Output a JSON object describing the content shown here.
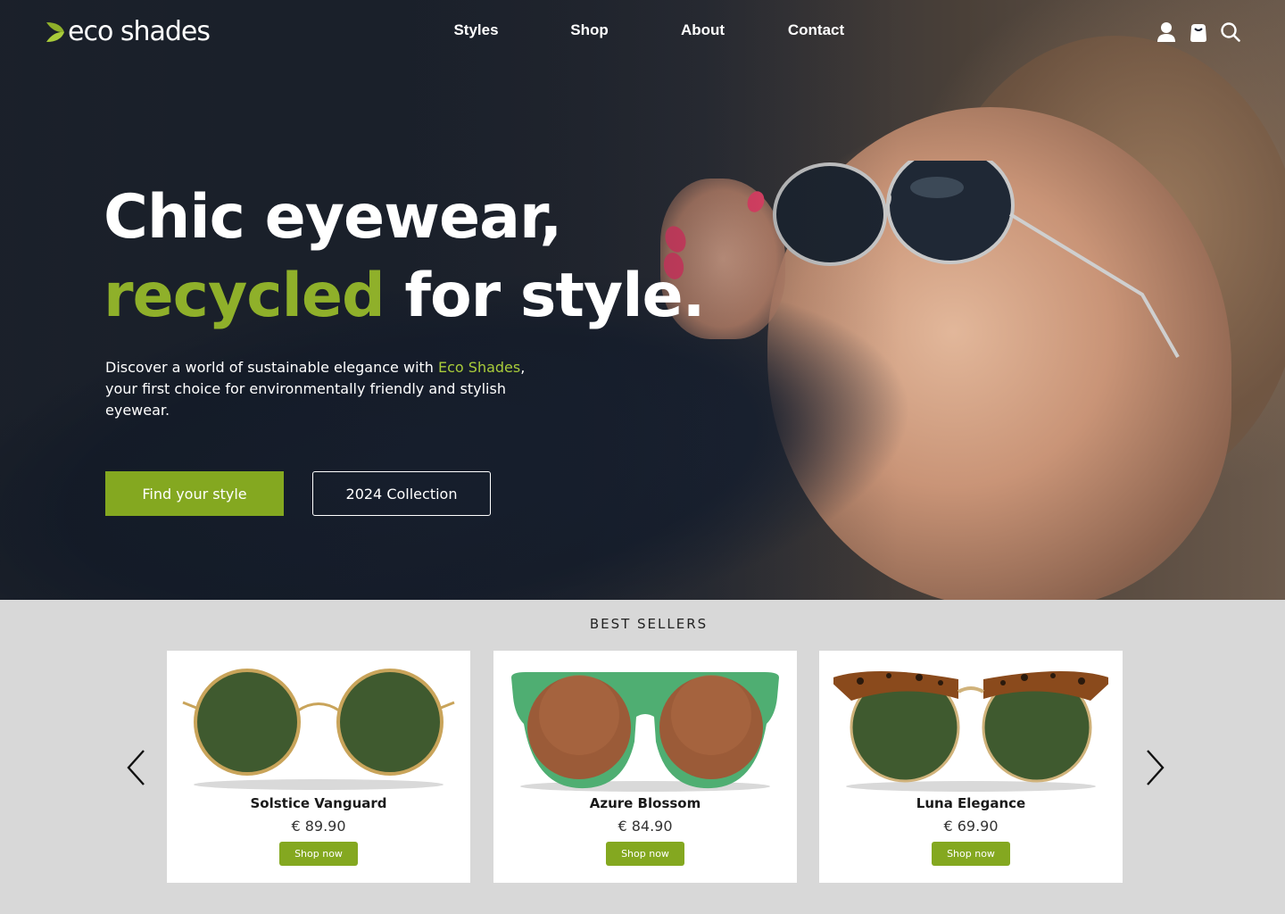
{
  "brand": {
    "logo_text": "eco shades",
    "accent_color": "#84a820"
  },
  "nav": {
    "links": [
      {
        "label": "Styles"
      },
      {
        "label": "Shop"
      },
      {
        "label": "About"
      },
      {
        "label": "Contact"
      }
    ],
    "icons": [
      "user-icon",
      "shopping-bag-icon",
      "search-icon"
    ]
  },
  "hero": {
    "headline_line1": "Chic eyewear,",
    "headline_accent": "recycled",
    "headline_rest": " for style.",
    "lead_before": "Discover a world of sustainable elegance with ",
    "lead_brand": "Eco Shades",
    "lead_after": ", your first choice for environmentally friendly and stylish eyewear.",
    "primary_button": "Find your style",
    "secondary_button": "2024 Collection"
  },
  "best_sellers": {
    "title": "BEST SELLERS",
    "products": [
      {
        "name": "Solstice Vanguard",
        "price": "€ 89.90",
        "button": "Shop now",
        "frame_color": "#c9a45a",
        "lens_color": "#3f5a2f"
      },
      {
        "name": "Azure Blossom",
        "price": "€ 84.90",
        "button": "Shop now",
        "frame_color": "#4fae72",
        "lens_color": "#9b5b38"
      },
      {
        "name": "Luna Elegance",
        "price": "€ 69.90",
        "button": "Shop now",
        "frame_color": "#8a4a1c",
        "lens_color": "#3f5a2f"
      }
    ]
  }
}
